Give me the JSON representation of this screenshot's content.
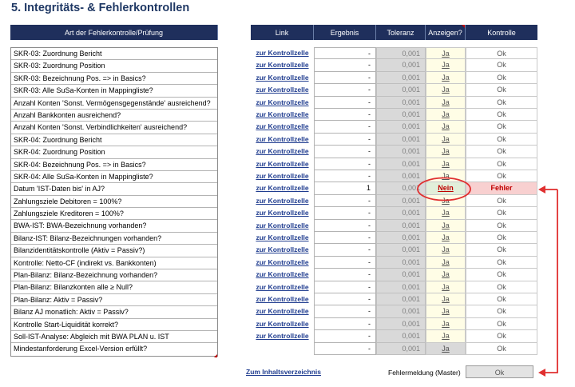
{
  "title": "5. Integritäts- & Fehlerkontrollen",
  "headers": {
    "art": "Art der Fehlerkontrolle/Prüfung",
    "link": "Link",
    "ergebnis": "Ergebnis",
    "toleranz": "Toleranz",
    "anzeigen": "Anzeigen?",
    "kontrolle": "Kontrolle"
  },
  "rows": [
    {
      "label": "SKR-03: Zuordnung Bericht",
      "link": "zur Kontrollzelle",
      "ergebnis": "-",
      "toleranz": "0,001",
      "anzeigen": "Ja",
      "kontrolle": "Ok"
    },
    {
      "label": "SKR-03: Zuordnung Position",
      "link": "zur Kontrollzelle",
      "ergebnis": "-",
      "toleranz": "0,001",
      "anzeigen": "Ja",
      "kontrolle": "Ok"
    },
    {
      "label": "SKR-03: Bezeichnung Pos. => in Basics?",
      "link": "zur Kontrollzelle",
      "ergebnis": "-",
      "toleranz": "0,001",
      "anzeigen": "Ja",
      "kontrolle": "Ok"
    },
    {
      "label": "SKR-03: Alle SuSa-Konten in Mappingliste?",
      "link": "zur Kontrollzelle",
      "ergebnis": "-",
      "toleranz": "0,001",
      "anzeigen": "Ja",
      "kontrolle": "Ok"
    },
    {
      "label": "Anzahl Konten 'Sonst. Vermögensgegenstände' ausreichend?",
      "link": "zur Kontrollzelle",
      "ergebnis": "-",
      "toleranz": "0,001",
      "anzeigen": "Ja",
      "kontrolle": "Ok"
    },
    {
      "label": "Anzahl Bankkonten ausreichend?",
      "link": "zur Kontrollzelle",
      "ergebnis": "-",
      "toleranz": "0,001",
      "anzeigen": "Ja",
      "kontrolle": "Ok"
    },
    {
      "label": "Anzahl Konten 'Sonst. Verbindlichkeiten' ausreichend?",
      "link": "zur Kontrollzelle",
      "ergebnis": "-",
      "toleranz": "0,001",
      "anzeigen": "Ja",
      "kontrolle": "Ok"
    },
    {
      "label": "SKR-04: Zuordnung Bericht",
      "link": "zur Kontrollzelle",
      "ergebnis": "-",
      "toleranz": "0,001",
      "anzeigen": "Ja",
      "kontrolle": "Ok"
    },
    {
      "label": "SKR-04: Zuordnung Position",
      "link": "zur Kontrollzelle",
      "ergebnis": "-",
      "toleranz": "0,001",
      "anzeigen": "Ja",
      "kontrolle": "Ok"
    },
    {
      "label": "SKR-04: Bezeichnung Pos. => in Basics?",
      "link": "zur Kontrollzelle",
      "ergebnis": "-",
      "toleranz": "0,001",
      "anzeigen": "Ja",
      "kontrolle": "Ok"
    },
    {
      "label": "SKR-04: Alle SuSa-Konten in Mappingliste?",
      "link": "zur Kontrollzelle",
      "ergebnis": "-",
      "toleranz": "0,001",
      "anzeigen": "Ja",
      "kontrolle": "Ok"
    },
    {
      "label": "Datum 'IST-Daten bis' in AJ?",
      "link": "zur Kontrollzelle",
      "ergebnis": "1",
      "toleranz": "0,001",
      "anzeigen": "Nein",
      "kontrolle": "Fehler",
      "error": true
    },
    {
      "label": "Zahlungsziele Debitoren = 100%?",
      "link": "zur Kontrollzelle",
      "ergebnis": "-",
      "toleranz": "0,001",
      "anzeigen": "Ja",
      "kontrolle": "Ok"
    },
    {
      "label": "Zahlungsziele Kreditoren = 100%?",
      "link": "zur Kontrollzelle",
      "ergebnis": "-",
      "toleranz": "0,001",
      "anzeigen": "Ja",
      "kontrolle": "Ok"
    },
    {
      "label": "BWA-IST: BWA-Bezeichnung vorhanden?",
      "link": "zur Kontrollzelle",
      "ergebnis": "-",
      "toleranz": "0,001",
      "anzeigen": "Ja",
      "kontrolle": "Ok"
    },
    {
      "label": "Bilanz-IST: Bilanz-Bezeichnungen vorhanden?",
      "link": "zur Kontrollzelle",
      "ergebnis": "-",
      "toleranz": "0,001",
      "anzeigen": "Ja",
      "kontrolle": "Ok"
    },
    {
      "label": "Bilanzidentitätskontrolle (Aktiv = Passiv?)",
      "link": "zur Kontrollzelle",
      "ergebnis": "-",
      "toleranz": "0,001",
      "anzeigen": "Ja",
      "kontrolle": "Ok"
    },
    {
      "label": "Kontrolle: Netto-CF (indirekt vs. Bankkonten)",
      "link": "zur Kontrollzelle",
      "ergebnis": "-",
      "toleranz": "0,001",
      "anzeigen": "Ja",
      "kontrolle": "Ok"
    },
    {
      "label": "Plan-Bilanz: Bilanz-Bezeichnung vorhanden?",
      "link": "zur Kontrollzelle",
      "ergebnis": "-",
      "toleranz": "0,001",
      "anzeigen": "Ja",
      "kontrolle": "Ok"
    },
    {
      "label": "Plan-Bilanz: Bilanzkonten alle ≥ Null?",
      "link": "zur Kontrollzelle",
      "ergebnis": "-",
      "toleranz": "0,001",
      "anzeigen": "Ja",
      "kontrolle": "Ok"
    },
    {
      "label": "Plan-Bilanz: Aktiv = Passiv?",
      "link": "zur Kontrollzelle",
      "ergebnis": "-",
      "toleranz": "0,001",
      "anzeigen": "Ja",
      "kontrolle": "Ok"
    },
    {
      "label": "Bilanz AJ monatlich: Aktiv = Passiv?",
      "link": "zur Kontrollzelle",
      "ergebnis": "-",
      "toleranz": "0,001",
      "anzeigen": "Ja",
      "kontrolle": "Ok"
    },
    {
      "label": "Kontrolle Start-Liquidität korrekt?",
      "link": "zur Kontrollzelle",
      "ergebnis": "-",
      "toleranz": "0,001",
      "anzeigen": "Ja",
      "kontrolle": "Ok"
    },
    {
      "label": "Soll-IST-Analyse: Abgleich mit BWA PLAN u. IST",
      "link": "zur Kontrollzelle",
      "ergebnis": "-",
      "toleranz": "0,001",
      "anzeigen": "Ja",
      "kontrolle": "Ok"
    },
    {
      "label": "Mindestanforderung Excel-Version erfüllt?",
      "link": "",
      "ergebnis": "-",
      "toleranz": "0,001",
      "anzeigen": "Ja",
      "kontrolle": "Ok",
      "grayAnz": true
    }
  ],
  "footer": {
    "toc_link": "Zum Inhaltsverzeichnis",
    "master_label": "Fehlermeldung (Master)",
    "master_value": "Ok"
  },
  "colors": {
    "header_bg": "#1f2f5c",
    "title": "#1f3864",
    "error_bg": "#f8d0d0",
    "error_text": "#c00000",
    "annotation": "#e03030"
  }
}
